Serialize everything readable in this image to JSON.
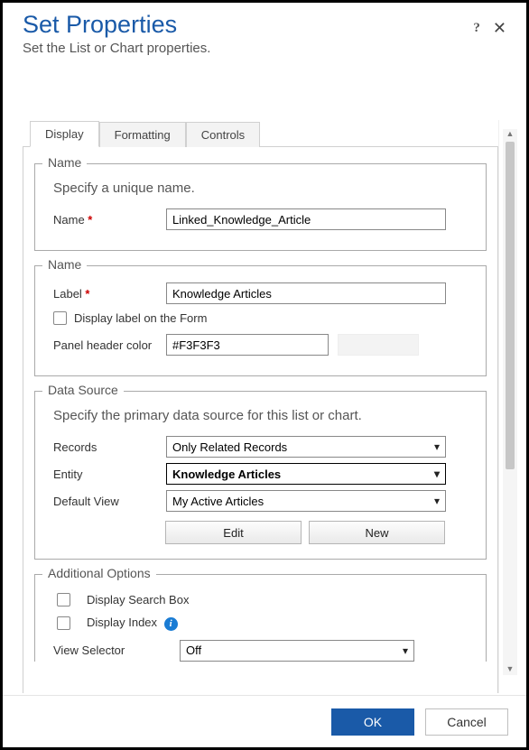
{
  "header": {
    "title": "Set Properties",
    "subtitle": "Set the List or Chart properties."
  },
  "tabs": {
    "display": "Display",
    "formatting": "Formatting",
    "controls": "Controls"
  },
  "section_name1": {
    "legend": "Name",
    "desc": "Specify a unique name.",
    "name_label": "Name",
    "name_value": "Linked_Knowledge_Article"
  },
  "section_name2": {
    "legend": "Name",
    "label_label": "Label",
    "label_value": "Knowledge Articles",
    "display_label_chk": "Display label on the Form",
    "panel_color_label": "Panel header color",
    "panel_color_value": "#F3F3F3"
  },
  "section_ds": {
    "legend": "Data Source",
    "desc": "Specify the primary data source for this list or chart.",
    "records_label": "Records",
    "records_value": "Only Related Records",
    "entity_label": "Entity",
    "entity_value": "Knowledge Articles",
    "defaultview_label": "Default View",
    "defaultview_value": "My Active Articles",
    "edit_btn": "Edit",
    "new_btn": "New"
  },
  "section_add": {
    "legend": "Additional Options",
    "search_chk": "Display Search Box",
    "index_chk": "Display Index",
    "viewselector_label": "View Selector",
    "viewselector_value": "Off"
  },
  "footer": {
    "ok": "OK",
    "cancel": "Cancel"
  }
}
